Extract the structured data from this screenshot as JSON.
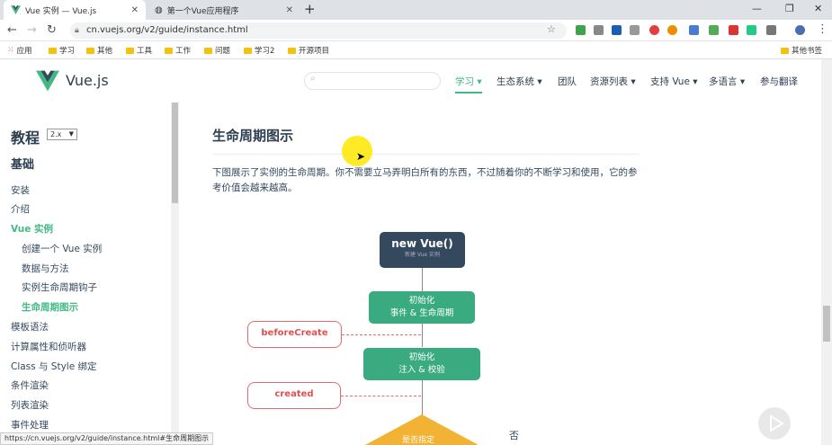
{
  "browser": {
    "tabs": [
      {
        "title": "Vue 实例 — Vue.js",
        "active": true
      },
      {
        "title": "第一个Vue应用程序",
        "active": false
      }
    ],
    "new_tab": "+",
    "url": "cn.vuejs.org/v2/guide/instance.html",
    "bookmarks": [
      "应用",
      "学习",
      "其他",
      "工具",
      "工作",
      "问题",
      "学习2",
      "开源项目"
    ],
    "other_bookmarks": "其他书签",
    "status_url": "https://cn.vuejs.org/v2/guide/instance.html#生命周期图示"
  },
  "site": {
    "brand": "Vue.js",
    "accent": "#42b983",
    "nav": [
      {
        "label": "学习 ▾",
        "active": true
      },
      {
        "label": "生态系统 ▾",
        "active": false
      },
      {
        "label": "团队",
        "active": false
      },
      {
        "label": "资源列表 ▾",
        "active": false
      },
      {
        "label": "支持 Vue ▾",
        "active": false
      },
      {
        "label": "多语言 ▾",
        "active": false
      },
      {
        "label": "参与翻译",
        "active": false
      }
    ]
  },
  "sidebar": {
    "title": "教程",
    "version": "2.x",
    "section": "基础",
    "items": [
      {
        "label": "安装",
        "level": 0,
        "active": false
      },
      {
        "label": "介绍",
        "level": 0,
        "active": false
      },
      {
        "label": "Vue 实例",
        "level": 0,
        "active": true
      },
      {
        "label": "创建一个 Vue 实例",
        "level": 1,
        "active": false
      },
      {
        "label": "数据与方法",
        "level": 1,
        "active": false
      },
      {
        "label": "实例生命周期钩子",
        "level": 1,
        "active": false
      },
      {
        "label": "生命周期图示",
        "level": 1,
        "active": true
      },
      {
        "label": "模板语法",
        "level": 0,
        "active": false
      },
      {
        "label": "计算属性和侦听器",
        "level": 0,
        "active": false
      },
      {
        "label": "Class 与 Style 绑定",
        "level": 0,
        "active": false
      },
      {
        "label": "条件渲染",
        "level": 0,
        "active": false
      },
      {
        "label": "列表渲染",
        "level": 0,
        "active": false
      },
      {
        "label": "事件处理",
        "level": 0,
        "active": false
      }
    ]
  },
  "content": {
    "heading": "生命周期图示",
    "paragraph": "下图展示了实例的生命周期。你不需要立马弄明白所有的东西，不过随着你的不断学习和使用，它的参考价值会越来越高。",
    "diagram": {
      "new_vue": "new Vue()",
      "new_vue_sub": "新建 Vue 实例",
      "init1_line1": "初始化",
      "init1_line2": "事件 & 生命周期",
      "before_create": "beforeCreate",
      "init2_line1": "初始化",
      "init2_line2": "注入 & 校验",
      "created": "created",
      "decision": "是否指定",
      "no": "否"
    }
  }
}
